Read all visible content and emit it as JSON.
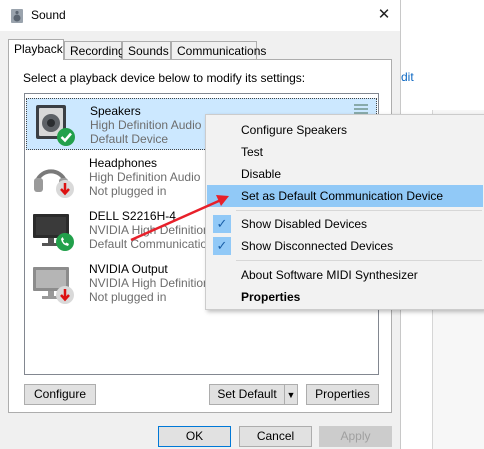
{
  "window": {
    "title": "Sound",
    "close_glyph": "✕"
  },
  "tabs": [
    {
      "label": "Playback",
      "active": true
    },
    {
      "label": "Recording",
      "active": false
    },
    {
      "label": "Sounds",
      "active": false
    },
    {
      "label": "Communications",
      "active": false
    }
  ],
  "instruction": "Select a playback device below to modify its settings:",
  "devices": [
    {
      "name": "Speakers",
      "line1": "High Definition Audio",
      "line2": "Default Device",
      "icon": "speaker-icon",
      "badge": "check-badge-icon",
      "selected": true
    },
    {
      "name": "Headphones",
      "line1": "High Definition Audio",
      "line2": "Not plugged in",
      "icon": "headphones-icon",
      "badge": "unplugged-arrow-icon",
      "selected": false
    },
    {
      "name": "DELL S2216H-4",
      "line1": "NVIDIA High Definition",
      "line2": "Default Communication",
      "icon": "monitor-icon",
      "badge": "phone-badge-icon",
      "selected": false
    },
    {
      "name": "NVIDIA Output",
      "line1": "NVIDIA High Definition",
      "line2": "Not plugged in",
      "icon": "monitor-icon",
      "badge": "unplugged-arrow-icon",
      "selected": false
    }
  ],
  "buttons": {
    "configure": "Configure",
    "set_default": "Set Default",
    "properties": "Properties",
    "ok": "OK",
    "cancel": "Cancel",
    "apply": "Apply"
  },
  "context_menu": {
    "items": [
      {
        "label": "Configure Speakers",
        "checked": false,
        "bold": false,
        "hover": false
      },
      {
        "label": "Test",
        "checked": false,
        "bold": false,
        "hover": false
      },
      {
        "label": "Disable",
        "checked": false,
        "bold": false,
        "hover": false
      },
      {
        "label": "Set as Default Communication Device",
        "checked": false,
        "bold": false,
        "hover": true
      },
      {
        "label": "Show Disabled Devices",
        "checked": true,
        "bold": false,
        "hover": false
      },
      {
        "label": "Show Disconnected Devices",
        "checked": true,
        "bold": false,
        "hover": false
      },
      {
        "label": "About Software MIDI Synthesizer",
        "checked": false,
        "bold": false,
        "hover": false
      },
      {
        "label": "Properties",
        "checked": false,
        "bold": true,
        "hover": false
      }
    ]
  },
  "background": {
    "link_fragment": "dit"
  },
  "colors": {
    "accent": "#0078d7",
    "menu_hover": "#91c9f7",
    "selection": "#cce8ff",
    "annotation_arrow": "#e8202a"
  }
}
